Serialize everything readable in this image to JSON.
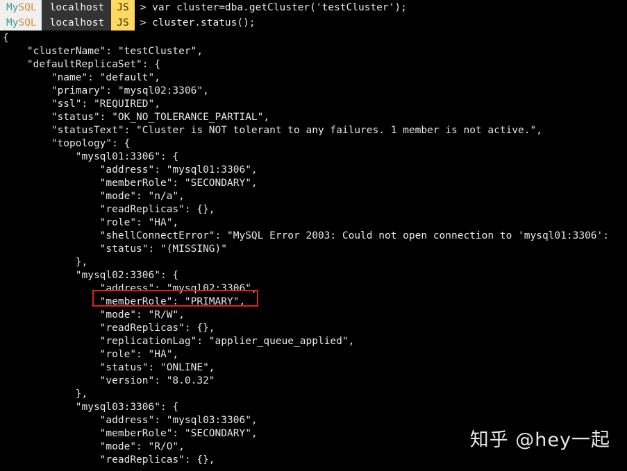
{
  "terminal": {
    "app": "MySQL Shell",
    "background_color": "#000000",
    "foreground_color": "#e8e8e8",
    "prompt_lines": [
      {
        "mysql_my": "My",
        "mysql_sql": "SQL",
        "host": "localhost",
        "mode": "JS",
        "command": "> var cluster=dba.getCluster('testCluster');"
      },
      {
        "mysql_my": "My",
        "mysql_sql": "SQL",
        "host": "localhost",
        "mode": "JS",
        "command": "> cluster.status();"
      }
    ],
    "output_lines": [
      "{",
      "    \"clusterName\": \"testCluster\",",
      "    \"defaultReplicaSet\": {",
      "        \"name\": \"default\",",
      "        \"primary\": \"mysql02:3306\",",
      "        \"ssl\": \"REQUIRED\",",
      "        \"status\": \"OK_NO_TOLERANCE_PARTIAL\",",
      "        \"statusText\": \"Cluster is NOT tolerant to any failures. 1 member is not active.\",",
      "        \"topology\": {",
      "            \"mysql01:3306\": {",
      "                \"address\": \"mysql01:3306\",",
      "                \"memberRole\": \"SECONDARY\",",
      "                \"mode\": \"n/a\",",
      "                \"readReplicas\": {},",
      "                \"role\": \"HA\",",
      "                \"shellConnectError\": \"MySQL Error 2003: Could not open connection to 'mysql01:3306':",
      "                \"status\": \"(MISSING)\"",
      "            },",
      "            \"mysql02:3306\": {",
      "                \"address\": \"mysql02:3306\",",
      "                \"memberRole\": \"PRIMARY\",",
      "                \"mode\": \"R/W\",",
      "                \"readReplicas\": {},",
      "                \"replicationLag\": \"applier_queue_applied\",",
      "                \"role\": \"HA\",",
      "                \"status\": \"ONLINE\",",
      "                \"version\": \"8.0.32\"",
      "            },",
      "            \"mysql03:3306\": {",
      "                \"address\": \"mysql03:3306\",",
      "                \"memberRole\": \"SECONDARY\",",
      "                \"mode\": \"R/O\",",
      "                \"readReplicas\": {},"
    ],
    "highlight": {
      "label": "memberRole-primary-highlight",
      "color": "#e02020",
      "target_text": "\"memberRole\": \"PRIMARY\","
    },
    "badge_colors": {
      "mysql_badge_bg": "#f0f0ee",
      "mysql_my_fg": "#3f9a91",
      "mysql_sql_fg": "#d98b43",
      "host_badge_bg": "#333333",
      "host_badge_fg": "#f2f2f2",
      "js_badge_bg": "#ffd862",
      "js_badge_fg": "#3a2f00"
    }
  },
  "watermark": {
    "text": "知乎 @hey一起"
  }
}
